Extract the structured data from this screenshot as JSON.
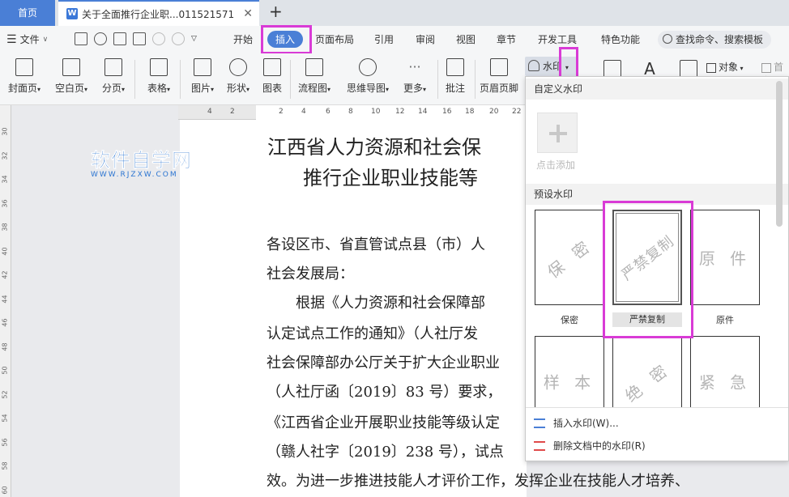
{
  "tabs": {
    "home": "首页",
    "doc_title": "关于全面推行企业职...011521571",
    "doc_icon": "W"
  },
  "menubar": {
    "file": "文件",
    "tabs": [
      "开始",
      "插入",
      "页面布局",
      "引用",
      "审阅",
      "视图",
      "章节",
      "开发工具",
      "特色功能"
    ],
    "active_tab": "插入",
    "search": "查找命令、搜索模板"
  },
  "ribbon": {
    "buttons": [
      "封面页",
      "空白页",
      "分页",
      "表格",
      "图片",
      "形状",
      "图表",
      "流程图",
      "思维导图",
      "更多",
      "批注",
      "页眉页脚"
    ],
    "watermark": "水印",
    "object": "对象",
    "first_char": "首字"
  },
  "hruler": [
    "4",
    "2",
    "2",
    "4",
    "6",
    "8",
    "10",
    "12",
    "14",
    "16",
    "18",
    "20",
    "22"
  ],
  "vruler": [
    "30",
    "32",
    "34",
    "36",
    "38",
    "40",
    "42",
    "44",
    "46",
    "48",
    "50",
    "52",
    "54",
    "56",
    "58",
    "60"
  ],
  "logo": {
    "main": "软件自学网",
    "sub": "WWW.RJZXW.COM"
  },
  "document": {
    "title_line1": "江西省人力资源和社会保",
    "title_line2": "推行企业职业技能等",
    "lines": [
      "各设区市、省直管试点县（市）人",
      "社会发展局：",
      "　　根据《人力资源和社会保障部",
      "认定试点工作的通知》（人社厅发",
      "社会保障部办公厅关于扩大企业职业",
      "（人社厅函〔2019〕83 号）要求，",
      "《江西省企业开展职业技能等级认定",
      "（赣人社字〔2019〕238 号），试点",
      "效。为进一步推进技能人才评价工作，发挥企业在技能人才培养、"
    ]
  },
  "dropdown": {
    "custom_section": "自定义水印",
    "custom_add": "点击添加",
    "preset_section": "预设水印",
    "presets": [
      {
        "text": "保 密",
        "label": "保密"
      },
      {
        "text": "严禁复制",
        "label": "严禁复制"
      },
      {
        "text": "原 件",
        "label": "原件"
      },
      {
        "text": "样 本",
        "label": ""
      },
      {
        "text": "绝 密",
        "label": ""
      },
      {
        "text": "紧 急",
        "label": ""
      }
    ],
    "insert_item": "插入水印(W)...",
    "delete_item": "删除文档中的水印(R)"
  }
}
